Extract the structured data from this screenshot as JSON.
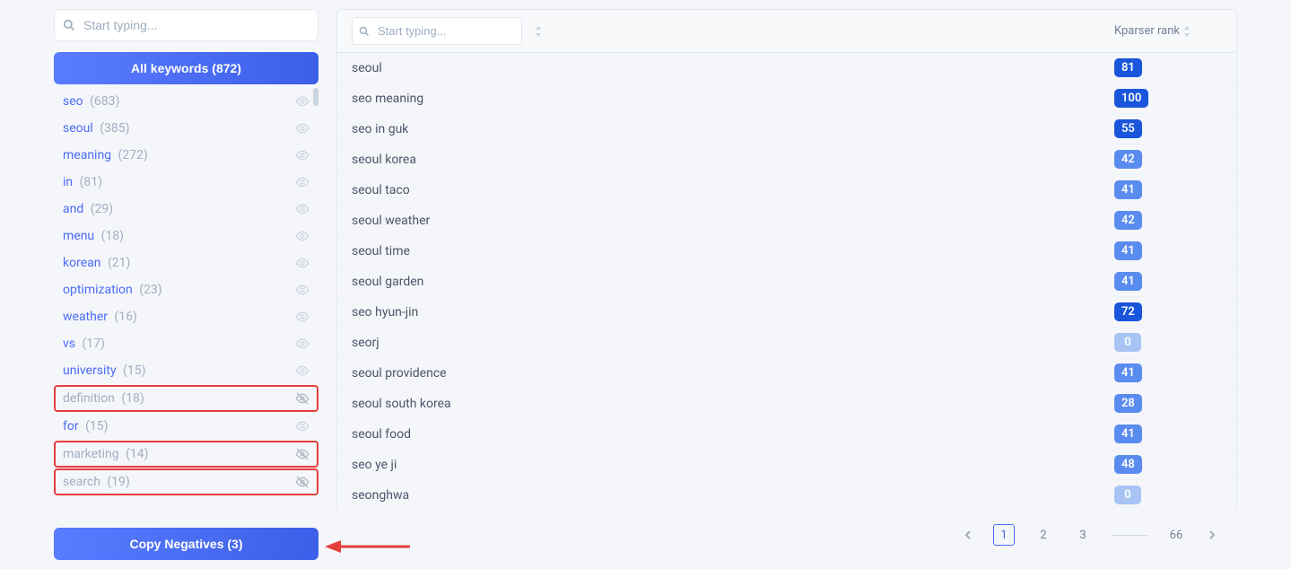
{
  "sidebar": {
    "search_placeholder": "Start typing...",
    "all_keywords_label": "All keywords (872)",
    "copy_negatives_label": "Copy Negatives (3)",
    "items": [
      {
        "label": "seo",
        "count": "(683)",
        "disabled": false,
        "highlighted": false,
        "eye_off": false
      },
      {
        "label": "seoul",
        "count": "(385)",
        "disabled": false,
        "highlighted": false,
        "eye_off": false
      },
      {
        "label": "meaning",
        "count": "(272)",
        "disabled": false,
        "highlighted": false,
        "eye_off": false
      },
      {
        "label": "in",
        "count": "(81)",
        "disabled": false,
        "highlighted": false,
        "eye_off": false
      },
      {
        "label": "and",
        "count": "(29)",
        "disabled": false,
        "highlighted": false,
        "eye_off": false
      },
      {
        "label": "menu",
        "count": "(18)",
        "disabled": false,
        "highlighted": false,
        "eye_off": false
      },
      {
        "label": "korean",
        "count": "(21)",
        "disabled": false,
        "highlighted": false,
        "eye_off": false
      },
      {
        "label": "optimization",
        "count": "(23)",
        "disabled": false,
        "highlighted": false,
        "eye_off": false
      },
      {
        "label": "weather",
        "count": "(16)",
        "disabled": false,
        "highlighted": false,
        "eye_off": false
      },
      {
        "label": "vs",
        "count": "(17)",
        "disabled": false,
        "highlighted": false,
        "eye_off": false
      },
      {
        "label": "university",
        "count": "(15)",
        "disabled": false,
        "highlighted": false,
        "eye_off": false
      },
      {
        "label": "definition",
        "count": "(18)",
        "disabled": true,
        "highlighted": true,
        "eye_off": true
      },
      {
        "label": "for",
        "count": "(15)",
        "disabled": false,
        "highlighted": false,
        "eye_off": false
      },
      {
        "label": "marketing",
        "count": "(14)",
        "disabled": true,
        "highlighted": true,
        "eye_off": true
      },
      {
        "label": "search",
        "count": "(19)",
        "disabled": true,
        "highlighted": true,
        "eye_off": true
      }
    ]
  },
  "table": {
    "search_placeholder": "Start typing...",
    "rank_header": "Kparser rank",
    "rows": [
      {
        "keyword": "seoul",
        "rank": "81",
        "tier": "high"
      },
      {
        "keyword": "seo meaning",
        "rank": "100",
        "tier": "high"
      },
      {
        "keyword": "seo in guk",
        "rank": "55",
        "tier": "high"
      },
      {
        "keyword": "seoul korea",
        "rank": "42",
        "tier": "med"
      },
      {
        "keyword": "seoul taco",
        "rank": "41",
        "tier": "med"
      },
      {
        "keyword": "seoul weather",
        "rank": "42",
        "tier": "med"
      },
      {
        "keyword": "seoul time",
        "rank": "41",
        "tier": "med"
      },
      {
        "keyword": "seoul garden",
        "rank": "41",
        "tier": "med"
      },
      {
        "keyword": "seo hyun-jin",
        "rank": "72",
        "tier": "high"
      },
      {
        "keyword": "seorj",
        "rank": "0",
        "tier": "low"
      },
      {
        "keyword": "seoul providence",
        "rank": "41",
        "tier": "med"
      },
      {
        "keyword": "seoul south korea",
        "rank": "28",
        "tier": "med"
      },
      {
        "keyword": "seoul food",
        "rank": "41",
        "tier": "med"
      },
      {
        "keyword": "seo ye ji",
        "rank": "48",
        "tier": "med"
      },
      {
        "keyword": "seonghwa",
        "rank": "0",
        "tier": "low"
      }
    ]
  },
  "pagination": {
    "pages": [
      "1",
      "2",
      "3"
    ],
    "last": "66",
    "active": 0
  }
}
